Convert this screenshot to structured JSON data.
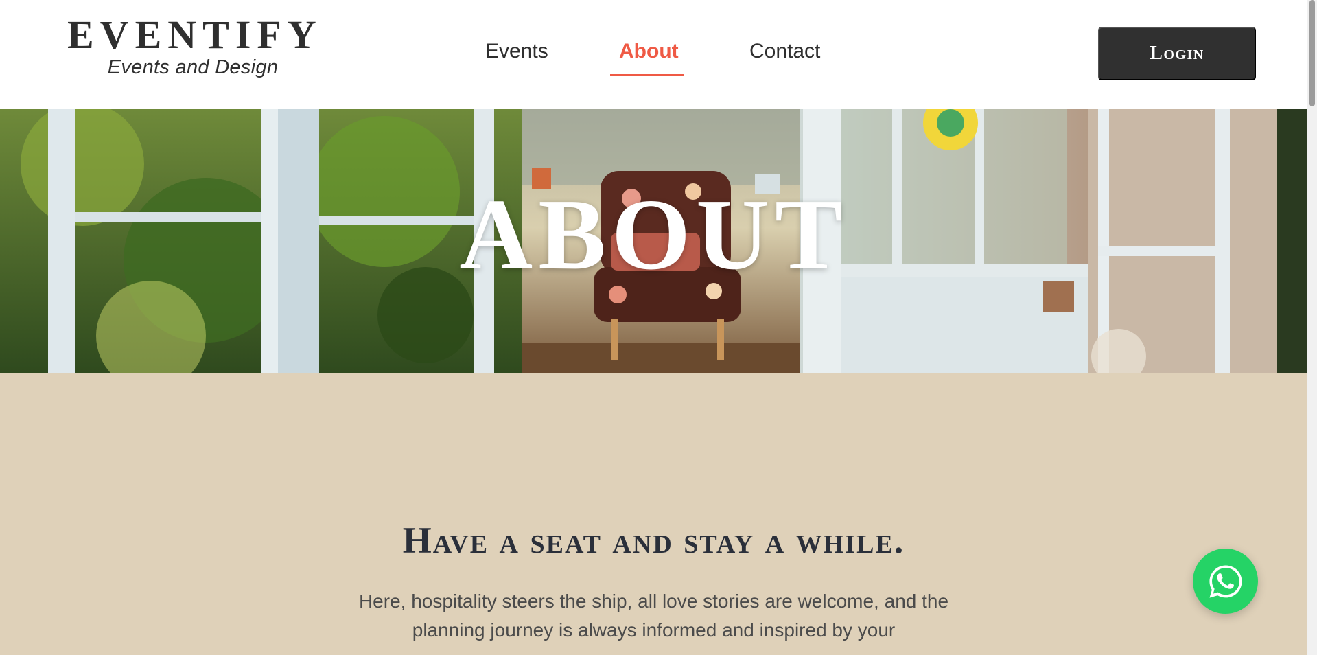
{
  "brand": {
    "name": "EVENTIFY",
    "tagline": "Events and Design"
  },
  "nav": {
    "items": [
      {
        "label": "Events",
        "active": false
      },
      {
        "label": "About",
        "active": true
      },
      {
        "label": "Contact",
        "active": false
      }
    ],
    "login_label": "Login"
  },
  "hero": {
    "title": "ABOUT",
    "image": "greenhouse-armchair-photo"
  },
  "content": {
    "heading": "Have a seat and stay a while.",
    "body": "Here, hospitality steers the ship, all love stories are welcome, and the planning journey is always informed and inspired by your"
  },
  "icons": {
    "whatsapp": "whatsapp-icon"
  },
  "colors": {
    "accent": "#ef5a45",
    "login_bg": "#303030",
    "section_bg": "#dfd1b9",
    "whatsapp": "#25d366"
  }
}
